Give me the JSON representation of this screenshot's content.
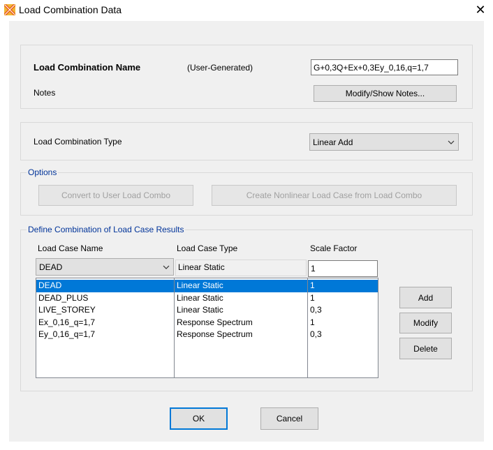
{
  "window": {
    "title": "Load Combination Data",
    "close_glyph": "✕"
  },
  "name_section": {
    "name_label": "Load Combination Name",
    "user_generated": "(User-Generated)",
    "name_value": "G+0,3Q+Ex+0,3Ey_0,16,q=1,7",
    "notes_label": "Notes",
    "notes_button": "Modify/Show Notes..."
  },
  "type_section": {
    "type_label": "Load Combination Type",
    "type_value": "Linear Add"
  },
  "options": {
    "legend": "Options",
    "convert_button": "Convert to User Load Combo",
    "create_button": "Create Nonlinear Load Case from Load Combo"
  },
  "define": {
    "legend": "Define Combination of Load Case Results",
    "col_name": "Load Case Name",
    "col_type": "Load Case Type",
    "col_scale": "Scale Factor",
    "edit_name": "DEAD",
    "edit_type": "Linear Static",
    "edit_scale": "1",
    "rows": [
      {
        "name": "DEAD",
        "type": "Linear Static",
        "scale": "1"
      },
      {
        "name": "DEAD_PLUS",
        "type": "Linear Static",
        "scale": "1"
      },
      {
        "name": "LIVE_STOREY",
        "type": "Linear Static",
        "scale": "0,3"
      },
      {
        "name": "Ex_0,16_q=1,7",
        "type": "Response Spectrum",
        "scale": "1"
      },
      {
        "name": "Ey_0,16_q=1,7",
        "type": "Response Spectrum",
        "scale": "0,3"
      }
    ],
    "add_button": "Add",
    "modify_button": "Modify",
    "delete_button": "Delete"
  },
  "footer": {
    "ok_button": "OK",
    "cancel_button": "Cancel"
  },
  "colors": {
    "accent": "#0078d7",
    "legend_text": "#003399",
    "app_icon_primary": "#e8601c",
    "app_icon_secondary": "#f2b632"
  },
  "icons": {
    "app": "sap-x-icon",
    "chevron": "chevron-down-icon",
    "close": "close-icon"
  }
}
